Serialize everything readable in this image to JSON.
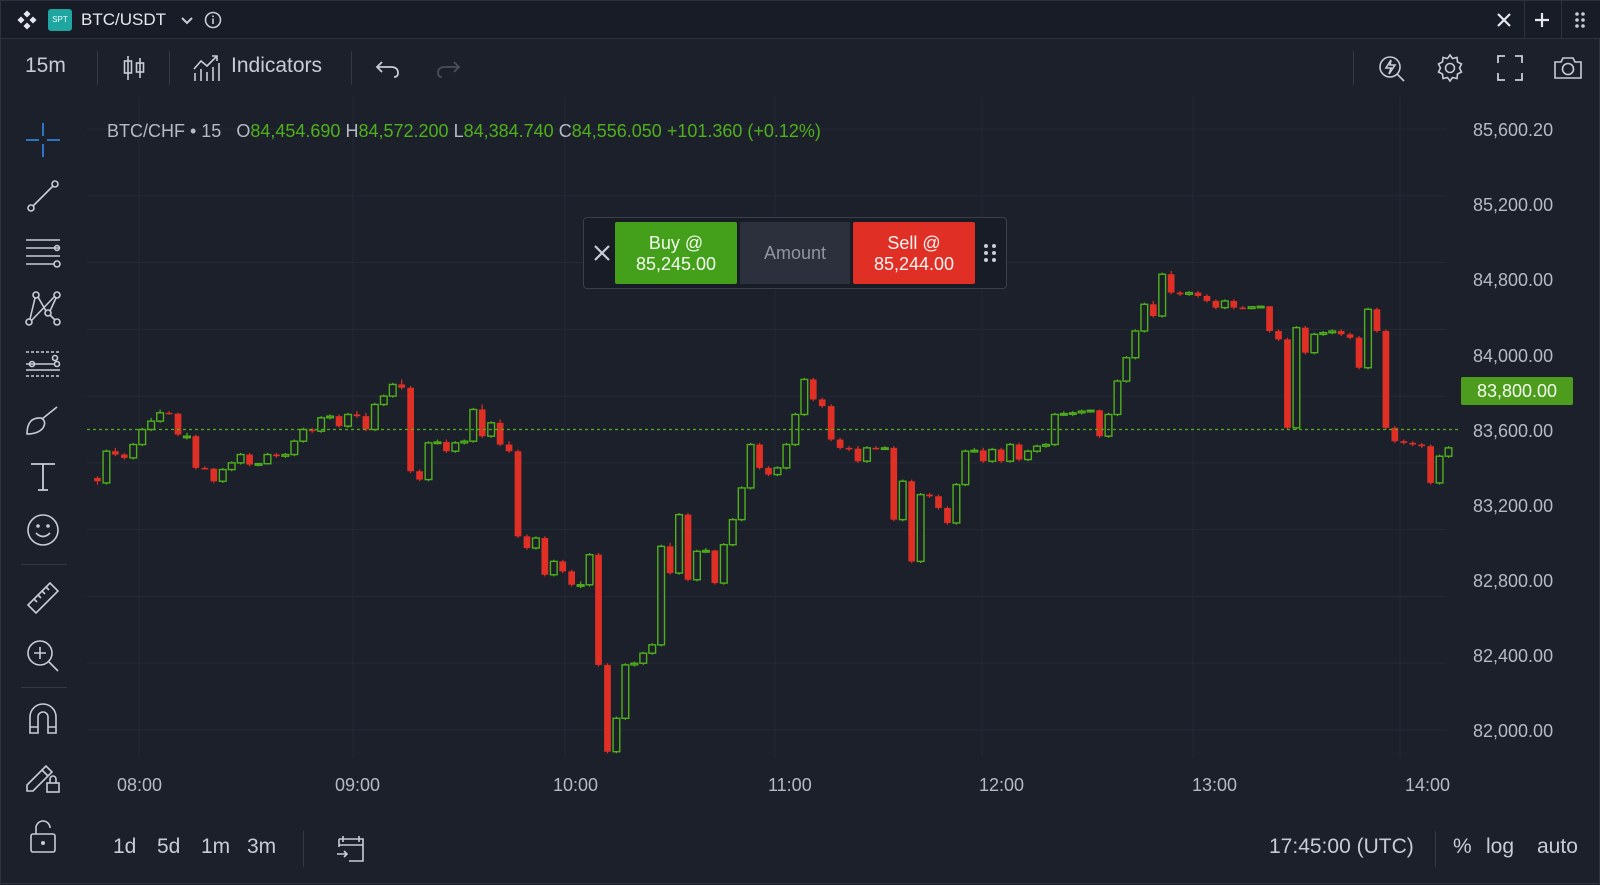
{
  "titlebar": {
    "badge": "SPT",
    "symbol": "BTC/USDT"
  },
  "toolbar": {
    "interval": "15m",
    "indicators_label": "Indicators"
  },
  "legend": {
    "symbol_interval": "BTC/CHF • 15",
    "open_key": "O",
    "open": "84,454.690",
    "high_key": "H",
    "high": "84,572.200",
    "low_key": "L",
    "low": "84,384.740",
    "close_key": "C",
    "close": "84,556.050",
    "change": "+101.360 (+0.12%)"
  },
  "order_panel": {
    "buy_line1": "Buy @",
    "buy_price": "85,245.00",
    "amount_label": "Amount",
    "sell_line1": "Sell @",
    "sell_price": "85,244.00"
  },
  "price_scale": {
    "labels": [
      "85,600.20",
      "85,200.00",
      "84,800.00",
      "84,000.00",
      "83,600.00",
      "83,200.00",
      "82,800.00",
      "82,400.00",
      "82,000.00"
    ],
    "current_price": "83,800.00"
  },
  "time_scale": {
    "labels": [
      "08:00",
      "09:00",
      "10:00",
      "11:00",
      "12:00",
      "13:00",
      "14:00"
    ]
  },
  "bottombar": {
    "ranges": [
      "1d",
      "5d",
      "1m",
      "3m"
    ],
    "clock": "17:45:00 (UTC)",
    "percent": "%",
    "log": "log",
    "auto": "auto"
  },
  "colors": {
    "up": "#4fb01a",
    "down": "#e03026",
    "background": "#1c202b",
    "accent": "#2f7fd8"
  },
  "icons": {
    "left_tools": [
      "crosshair-icon",
      "trend-line-icon",
      "fib-lines-icon",
      "pattern-icon",
      "forecast-icon",
      "brush-icon",
      "text-icon",
      "emoji-icon",
      "ruler-icon",
      "zoom-in-icon",
      "magnet-icon",
      "lock-drawing-icon",
      "lock-icon"
    ],
    "right_toolbar": [
      "quick-trade-icon",
      "settings-icon",
      "fullscreen-icon",
      "camera-icon"
    ]
  },
  "chart_data": {
    "type": "candlestick",
    "title": "BTC/CHF • 15",
    "xlabel": "",
    "ylabel": "",
    "ylim": [
      81800,
      85700
    ],
    "x_ticks": [
      "08:00",
      "09:00",
      "10:00",
      "11:00",
      "12:00",
      "13:00",
      "14:00"
    ],
    "current_price": 83800,
    "candles": [
      {
        "o": 83510,
        "h": 83520,
        "l": 83470,
        "c": 83490
      },
      {
        "o": 83480,
        "h": 83680,
        "l": 83470,
        "c": 83670
      },
      {
        "o": 83670,
        "h": 83690,
        "l": 83640,
        "c": 83650
      },
      {
        "o": 83650,
        "h": 83660,
        "l": 83620,
        "c": 83630
      },
      {
        "o": 83630,
        "h": 83720,
        "l": 83620,
        "c": 83710
      },
      {
        "o": 83710,
        "h": 83810,
        "l": 83700,
        "c": 83800
      },
      {
        "o": 83800,
        "h": 83870,
        "l": 83790,
        "c": 83850
      },
      {
        "o": 83850,
        "h": 83920,
        "l": 83840,
        "c": 83900
      },
      {
        "o": 83900,
        "h": 83910,
        "l": 83890,
        "c": 83895
      },
      {
        "o": 83895,
        "h": 83900,
        "l": 83760,
        "c": 83770
      },
      {
        "o": 83760,
        "h": 83780,
        "l": 83740,
        "c": 83760
      },
      {
        "o": 83760,
        "h": 83770,
        "l": 83560,
        "c": 83570
      },
      {
        "o": 83570,
        "h": 83580,
        "l": 83560,
        "c": 83565
      },
      {
        "o": 83565,
        "h": 83570,
        "l": 83480,
        "c": 83490
      },
      {
        "o": 83490,
        "h": 83570,
        "l": 83480,
        "c": 83560
      },
      {
        "o": 83560,
        "h": 83610,
        "l": 83550,
        "c": 83600
      },
      {
        "o": 83600,
        "h": 83660,
        "l": 83590,
        "c": 83650
      },
      {
        "o": 83650,
        "h": 83660,
        "l": 83580,
        "c": 83590
      },
      {
        "o": 83590,
        "h": 83600,
        "l": 83580,
        "c": 83595
      },
      {
        "o": 83595,
        "h": 83660,
        "l": 83590,
        "c": 83650
      },
      {
        "o": 83650,
        "h": 83660,
        "l": 83630,
        "c": 83640
      },
      {
        "o": 83640,
        "h": 83660,
        "l": 83630,
        "c": 83650
      },
      {
        "o": 83650,
        "h": 83740,
        "l": 83640,
        "c": 83730
      },
      {
        "o": 83730,
        "h": 83810,
        "l": 83720,
        "c": 83800
      },
      {
        "o": 83800,
        "h": 83810,
        "l": 83780,
        "c": 83790
      },
      {
        "o": 83790,
        "h": 83880,
        "l": 83780,
        "c": 83870
      },
      {
        "o": 83870,
        "h": 83890,
        "l": 83860,
        "c": 83880
      },
      {
        "o": 83880,
        "h": 83890,
        "l": 83810,
        "c": 83820
      },
      {
        "o": 83820,
        "h": 83900,
        "l": 83810,
        "c": 83890
      },
      {
        "o": 83890,
        "h": 83910,
        "l": 83870,
        "c": 83880
      },
      {
        "o": 83880,
        "h": 83900,
        "l": 83790,
        "c": 83800
      },
      {
        "o": 83800,
        "h": 83960,
        "l": 83790,
        "c": 83950
      },
      {
        "o": 83950,
        "h": 84010,
        "l": 83940,
        "c": 84000
      },
      {
        "o": 84000,
        "h": 84080,
        "l": 83990,
        "c": 84070
      },
      {
        "o": 84070,
        "h": 84100,
        "l": 84040,
        "c": 84050
      },
      {
        "o": 84050,
        "h": 84060,
        "l": 83540,
        "c": 83550
      },
      {
        "o": 83550,
        "h": 83560,
        "l": 83490,
        "c": 83500
      },
      {
        "o": 83500,
        "h": 83730,
        "l": 83490,
        "c": 83720
      },
      {
        "o": 83720,
        "h": 83740,
        "l": 83710,
        "c": 83725
      },
      {
        "o": 83725,
        "h": 83740,
        "l": 83660,
        "c": 83670
      },
      {
        "o": 83670,
        "h": 83730,
        "l": 83660,
        "c": 83720
      },
      {
        "o": 83720,
        "h": 83740,
        "l": 83710,
        "c": 83730
      },
      {
        "o": 83730,
        "h": 83930,
        "l": 83720,
        "c": 83920
      },
      {
        "o": 83920,
        "h": 83950,
        "l": 83750,
        "c": 83760
      },
      {
        "o": 83760,
        "h": 83850,
        "l": 83750,
        "c": 83840
      },
      {
        "o": 83840,
        "h": 83860,
        "l": 83700,
        "c": 83710
      },
      {
        "o": 83710,
        "h": 83730,
        "l": 83660,
        "c": 83670
      },
      {
        "o": 83670,
        "h": 83680,
        "l": 83150,
        "c": 83160
      },
      {
        "o": 83160,
        "h": 83170,
        "l": 83080,
        "c": 83090
      },
      {
        "o": 83090,
        "h": 83160,
        "l": 83080,
        "c": 83150
      },
      {
        "o": 83150,
        "h": 83160,
        "l": 82920,
        "c": 82930
      },
      {
        "o": 82930,
        "h": 83020,
        "l": 82920,
        "c": 83010
      },
      {
        "o": 83010,
        "h": 83020,
        "l": 82940,
        "c": 82950
      },
      {
        "o": 82950,
        "h": 82960,
        "l": 82860,
        "c": 82870
      },
      {
        "o": 82870,
        "h": 82890,
        "l": 82850,
        "c": 82870
      },
      {
        "o": 82870,
        "h": 83060,
        "l": 82860,
        "c": 83050
      },
      {
        "o": 83050,
        "h": 83060,
        "l": 82380,
        "c": 82390
      },
      {
        "o": 82390,
        "h": 82400,
        "l": 81860,
        "c": 81870
      },
      {
        "o": 81870,
        "h": 82080,
        "l": 81860,
        "c": 82070
      },
      {
        "o": 82070,
        "h": 82400,
        "l": 82060,
        "c": 82390
      },
      {
        "o": 82390,
        "h": 82410,
        "l": 82380,
        "c": 82400
      },
      {
        "o": 82400,
        "h": 82470,
        "l": 82390,
        "c": 82460
      },
      {
        "o": 82460,
        "h": 82520,
        "l": 82450,
        "c": 82510
      },
      {
        "o": 82510,
        "h": 83110,
        "l": 82500,
        "c": 83100
      },
      {
        "o": 83100,
        "h": 83120,
        "l": 82930,
        "c": 82940
      },
      {
        "o": 82940,
        "h": 83300,
        "l": 82930,
        "c": 83290
      },
      {
        "o": 83290,
        "h": 83300,
        "l": 82890,
        "c": 82900
      },
      {
        "o": 82900,
        "h": 83080,
        "l": 82890,
        "c": 83070
      },
      {
        "o": 83070,
        "h": 83090,
        "l": 83060,
        "c": 83075
      },
      {
        "o": 83075,
        "h": 83080,
        "l": 82870,
        "c": 82880
      },
      {
        "o": 82880,
        "h": 83120,
        "l": 82870,
        "c": 83110
      },
      {
        "o": 83110,
        "h": 83270,
        "l": 83100,
        "c": 83260
      },
      {
        "o": 83260,
        "h": 83460,
        "l": 83250,
        "c": 83450
      },
      {
        "o": 83450,
        "h": 83720,
        "l": 83440,
        "c": 83710
      },
      {
        "o": 83710,
        "h": 83720,
        "l": 83560,
        "c": 83570
      },
      {
        "o": 83570,
        "h": 83580,
        "l": 83520,
        "c": 83530
      },
      {
        "o": 83530,
        "h": 83580,
        "l": 83520,
        "c": 83570
      },
      {
        "o": 83570,
        "h": 83720,
        "l": 83560,
        "c": 83710
      },
      {
        "o": 83710,
        "h": 83900,
        "l": 83700,
        "c": 83890
      },
      {
        "o": 83890,
        "h": 84110,
        "l": 83880,
        "c": 84100
      },
      {
        "o": 84100,
        "h": 84110,
        "l": 83970,
        "c": 83980
      },
      {
        "o": 83980,
        "h": 83990,
        "l": 83930,
        "c": 83940
      },
      {
        "o": 83940,
        "h": 83950,
        "l": 83730,
        "c": 83740
      },
      {
        "o": 83740,
        "h": 83750,
        "l": 83680,
        "c": 83690
      },
      {
        "o": 83690,
        "h": 83700,
        "l": 83670,
        "c": 83685
      },
      {
        "o": 83685,
        "h": 83700,
        "l": 83600,
        "c": 83610
      },
      {
        "o": 83610,
        "h": 83700,
        "l": 83600,
        "c": 83690
      },
      {
        "o": 83690,
        "h": 83700,
        "l": 83680,
        "c": 83688
      },
      {
        "o": 83688,
        "h": 83700,
        "l": 83680,
        "c": 83690
      },
      {
        "o": 83690,
        "h": 83700,
        "l": 83250,
        "c": 83260
      },
      {
        "o": 83260,
        "h": 83500,
        "l": 83250,
        "c": 83490
      },
      {
        "o": 83490,
        "h": 83500,
        "l": 83000,
        "c": 83010
      },
      {
        "o": 83010,
        "h": 83420,
        "l": 83000,
        "c": 83410
      },
      {
        "o": 83410,
        "h": 83420,
        "l": 83390,
        "c": 83400
      },
      {
        "o": 83400,
        "h": 83410,
        "l": 83320,
        "c": 83330
      },
      {
        "o": 83330,
        "h": 83340,
        "l": 83230,
        "c": 83240
      },
      {
        "o": 83240,
        "h": 83480,
        "l": 83230,
        "c": 83470
      },
      {
        "o": 83470,
        "h": 83680,
        "l": 83460,
        "c": 83670
      },
      {
        "o": 83670,
        "h": 83690,
        "l": 83660,
        "c": 83675
      },
      {
        "o": 83675,
        "h": 83690,
        "l": 83600,
        "c": 83610
      },
      {
        "o": 83610,
        "h": 83690,
        "l": 83600,
        "c": 83680
      },
      {
        "o": 83680,
        "h": 83690,
        "l": 83600,
        "c": 83610
      },
      {
        "o": 83610,
        "h": 83720,
        "l": 83600,
        "c": 83710
      },
      {
        "o": 83710,
        "h": 83720,
        "l": 83610,
        "c": 83620
      },
      {
        "o": 83620,
        "h": 83680,
        "l": 83610,
        "c": 83670
      },
      {
        "o": 83670,
        "h": 83710,
        "l": 83660,
        "c": 83700
      },
      {
        "o": 83700,
        "h": 83720,
        "l": 83690,
        "c": 83710
      },
      {
        "o": 83710,
        "h": 83900,
        "l": 83700,
        "c": 83890
      },
      {
        "o": 83890,
        "h": 83910,
        "l": 83880,
        "c": 83895
      },
      {
        "o": 83895,
        "h": 83910,
        "l": 83880,
        "c": 83900
      },
      {
        "o": 83900,
        "h": 83920,
        "l": 83890,
        "c": 83910
      },
      {
        "o": 83910,
        "h": 83920,
        "l": 83900,
        "c": 83915
      },
      {
        "o": 83915,
        "h": 83920,
        "l": 83750,
        "c": 83760
      },
      {
        "o": 83760,
        "h": 83900,
        "l": 83750,
        "c": 83890
      },
      {
        "o": 83890,
        "h": 84100,
        "l": 83880,
        "c": 84090
      },
      {
        "o": 84090,
        "h": 84240,
        "l": 84080,
        "c": 84230
      },
      {
        "o": 84230,
        "h": 84400,
        "l": 84220,
        "c": 84390
      },
      {
        "o": 84390,
        "h": 84560,
        "l": 84380,
        "c": 84550
      },
      {
        "o": 84550,
        "h": 84570,
        "l": 84470,
        "c": 84480
      },
      {
        "o": 84480,
        "h": 84740,
        "l": 84470,
        "c": 84730
      },
      {
        "o": 84730,
        "h": 84750,
        "l": 84610,
        "c": 84620
      },
      {
        "o": 84620,
        "h": 84630,
        "l": 84600,
        "c": 84610
      },
      {
        "o": 84610,
        "h": 84630,
        "l": 84600,
        "c": 84620
      },
      {
        "o": 84620,
        "h": 84630,
        "l": 84590,
        "c": 84600
      },
      {
        "o": 84600,
        "h": 84610,
        "l": 84560,
        "c": 84570
      },
      {
        "o": 84570,
        "h": 84580,
        "l": 84520,
        "c": 84530
      },
      {
        "o": 84530,
        "h": 84580,
        "l": 84520,
        "c": 84570
      },
      {
        "o": 84570,
        "h": 84580,
        "l": 84520,
        "c": 84530
      },
      {
        "o": 84530,
        "h": 84540,
        "l": 84520,
        "c": 84525
      },
      {
        "o": 84525,
        "h": 84540,
        "l": 84520,
        "c": 84535
      },
      {
        "o": 84535,
        "h": 84540,
        "l": 84530,
        "c": 84538
      },
      {
        "o": 84538,
        "h": 84540,
        "l": 84380,
        "c": 84390
      },
      {
        "o": 84390,
        "h": 84400,
        "l": 84330,
        "c": 84340
      },
      {
        "o": 84340,
        "h": 84350,
        "l": 83800,
        "c": 83810
      },
      {
        "o": 83810,
        "h": 84420,
        "l": 83800,
        "c": 84410
      },
      {
        "o": 84410,
        "h": 84420,
        "l": 84250,
        "c": 84260
      },
      {
        "o": 84260,
        "h": 84380,
        "l": 84250,
        "c": 84370
      },
      {
        "o": 84370,
        "h": 84390,
        "l": 84360,
        "c": 84380
      },
      {
        "o": 84380,
        "h": 84400,
        "l": 84370,
        "c": 84390
      },
      {
        "o": 84390,
        "h": 84400,
        "l": 84360,
        "c": 84370
      },
      {
        "o": 84370,
        "h": 84380,
        "l": 84340,
        "c": 84350
      },
      {
        "o": 84350,
        "h": 84360,
        "l": 84160,
        "c": 84170
      },
      {
        "o": 84170,
        "h": 84530,
        "l": 84160,
        "c": 84520
      },
      {
        "o": 84520,
        "h": 84530,
        "l": 84380,
        "c": 84390
      },
      {
        "o": 84390,
        "h": 84400,
        "l": 83800,
        "c": 83810
      },
      {
        "o": 83810,
        "h": 83820,
        "l": 83720,
        "c": 83730
      },
      {
        "o": 83730,
        "h": 83740,
        "l": 83710,
        "c": 83720
      },
      {
        "o": 83720,
        "h": 83730,
        "l": 83700,
        "c": 83710
      },
      {
        "o": 83710,
        "h": 83720,
        "l": 83690,
        "c": 83700
      },
      {
        "o": 83700,
        "h": 83710,
        "l": 83470,
        "c": 83480
      },
      {
        "o": 83480,
        "h": 83650,
        "l": 83470,
        "c": 83640
      },
      {
        "o": 83640,
        "h": 83700,
        "l": 83630,
        "c": 83690
      }
    ]
  }
}
